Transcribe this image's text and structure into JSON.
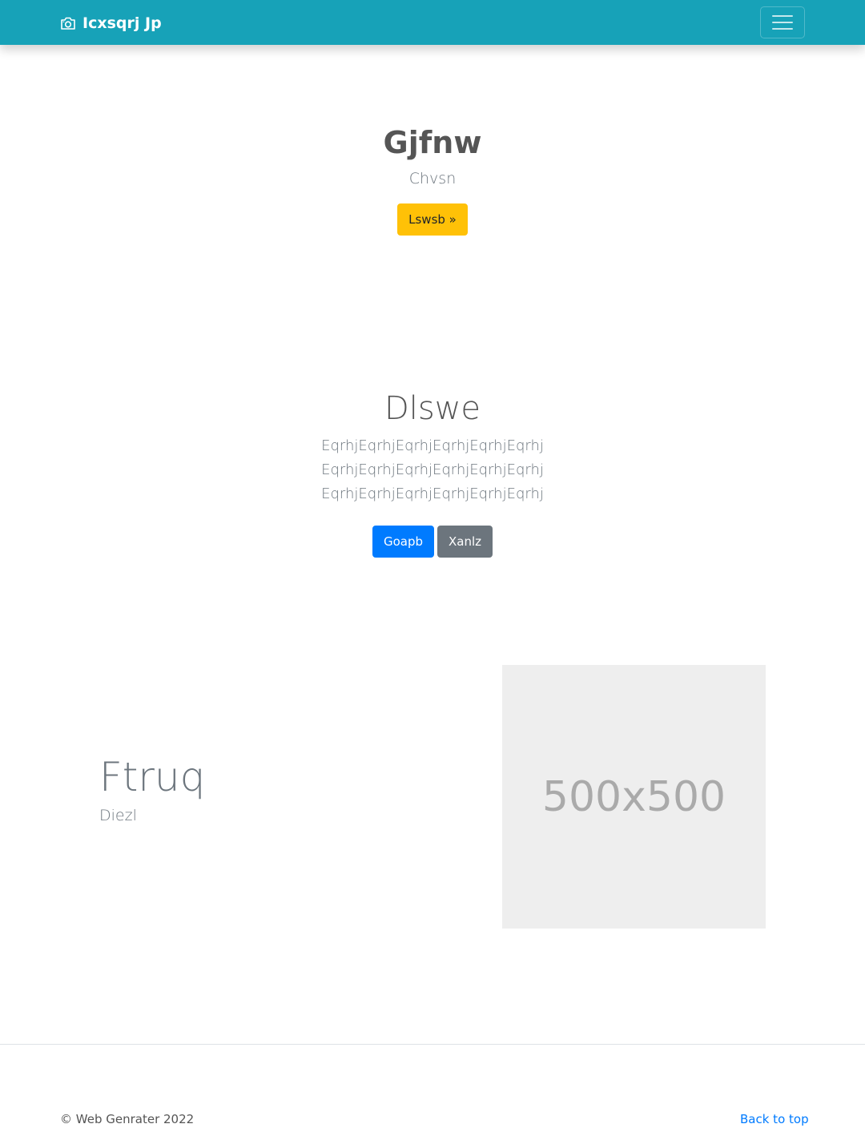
{
  "navbar": {
    "brand_text": "Icxsqrj Jp",
    "brand_icon": "camera-icon",
    "toggler_icon": "hamburger-menu-icon",
    "background": "#17a2b8"
  },
  "hero": {
    "title": "Gjfnw",
    "subtitle": "Chvsn",
    "button_label": "Lswsb »"
  },
  "section2": {
    "title": "Dlswe",
    "lead": "EqrhjEqrhjEqrhjEqrhjEqrhjEqrhj EqrhjEqrhjEqrhjEqrhjEqrhjEqrhj EqrhjEqrhjEqrhjEqrhjEqrhjEqrhj",
    "primary_button": "Goapb",
    "secondary_button": "Xanlz"
  },
  "feature": {
    "title": "Ftruq",
    "subtitle": "Diezl",
    "image_placeholder": "500x500"
  },
  "footer": {
    "copyright": "© Web Genrater 2022",
    "back_to_top": "Back to top"
  },
  "colors": {
    "primary": "#007bff",
    "warning": "#ffc107",
    "secondary": "#6c757d"
  }
}
